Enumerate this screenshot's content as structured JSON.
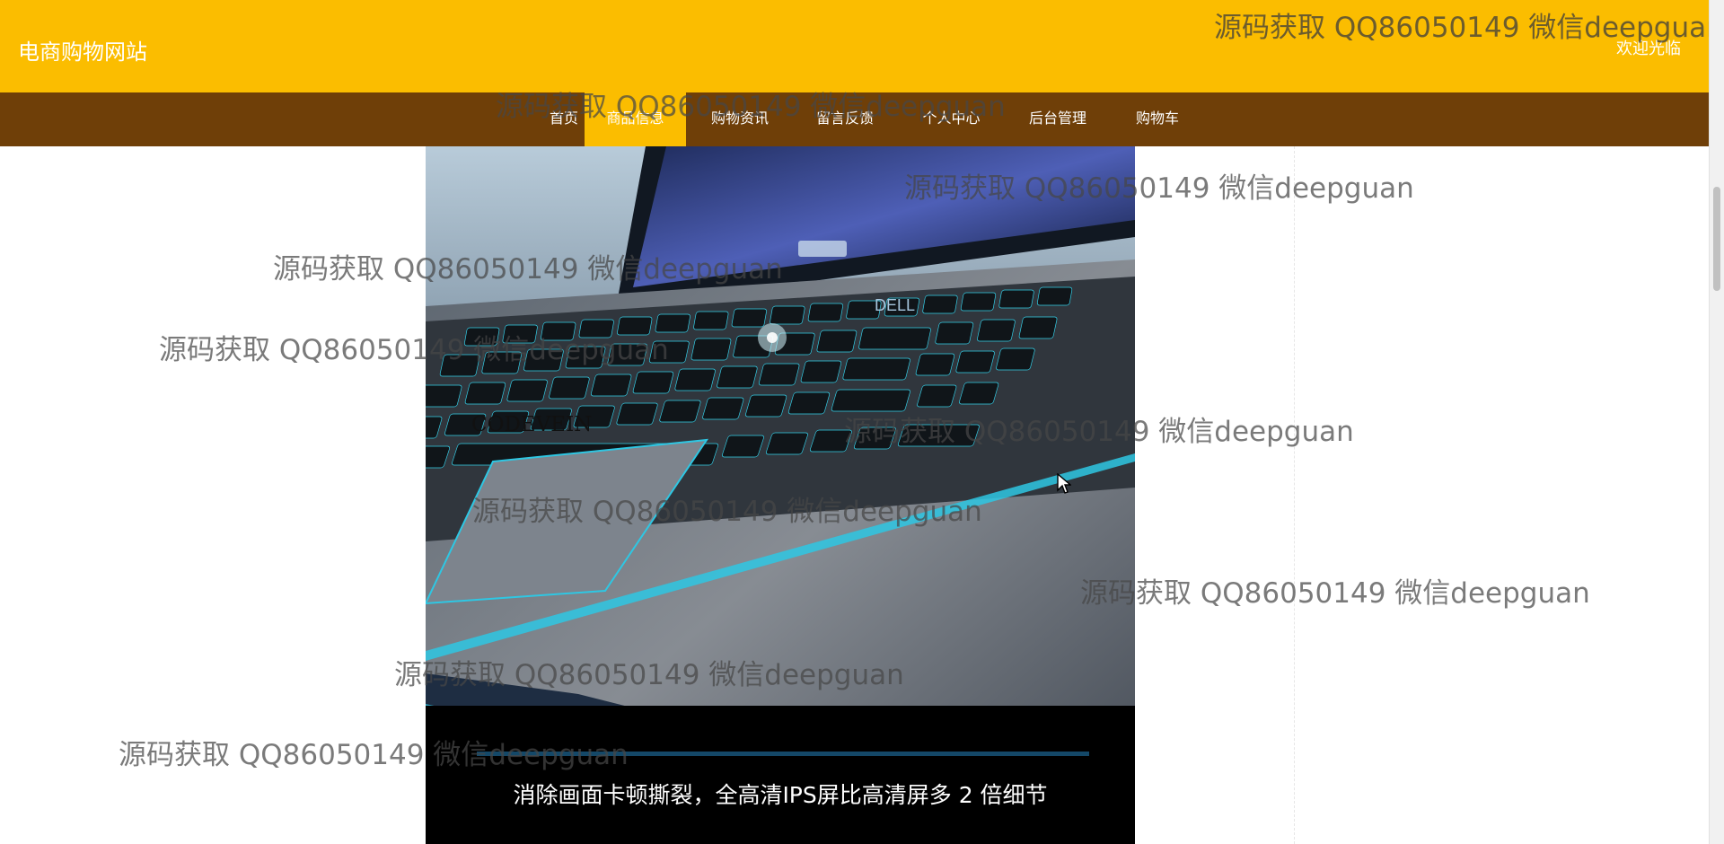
{
  "site": {
    "title": "电商购物网站",
    "welcome": "欢迎光临"
  },
  "nav": {
    "items": [
      {
        "label": "首页"
      },
      {
        "label": "商品信息"
      },
      {
        "label": "购物资讯"
      },
      {
        "label": "留言反馈"
      },
      {
        "label": "个人中心"
      },
      {
        "label": "后台管理"
      },
      {
        "label": "购物车"
      }
    ]
  },
  "product": {
    "image_alt_brand": "DELL",
    "game_logo": "CODEVEIN",
    "caption": "消除画面卡顿撕裂，全高清IPS屏比高清屏多 2 倍细节"
  },
  "watermarks": [
    "源码获取 QQ86050149 微信deepguan",
    "源码获取 QQ86050149 微信deepguan",
    "源码获取 QQ86050149 微信deepguan",
    "源码获取 QQ86050149 微信deepguan",
    "源码获取 QQ86050149 微信deepguan",
    "源码获取 QQ86050149 微信deepguan",
    "源码获取 QQ86050149 微信deepguan",
    "源码获取 QQ86050149 微信deepguan",
    "源码获取 QQ86050149 微信deepguan",
    "源码获取 QQ86050149 微信deepguan"
  ],
  "colors": {
    "header": "#fbbd00",
    "nav": "#6f3f08",
    "nav_active": "#fbbd00"
  }
}
